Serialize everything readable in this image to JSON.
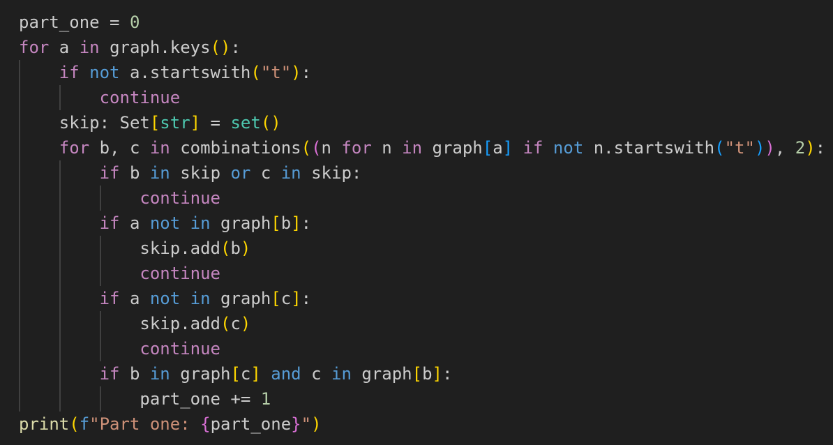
{
  "editor": {
    "language": "python",
    "theme_colors": {
      "background": "#1f1f1f",
      "default_text": "#cccccc",
      "control_keyword": "#c586c0",
      "keyword": "#569cd6",
      "function_builtin": "#dcdcaa",
      "string": "#ce9178",
      "number": "#b5cea8",
      "type": "#4ec9b0",
      "bracket_level_1": "#ffd700",
      "bracket_level_2": "#da70d6",
      "bracket_level_3": "#179fff",
      "indent_guide": "#404040"
    },
    "lines": [
      {
        "indent": 0,
        "tokens": [
          [
            "var",
            "part_one"
          ],
          [
            "var",
            " = "
          ],
          [
            "num",
            "0"
          ]
        ]
      },
      {
        "indent": 0,
        "tokens": [
          [
            "kw-ctrl",
            "for"
          ],
          [
            "var",
            " a "
          ],
          [
            "kw-ctrl",
            "in"
          ],
          [
            "var",
            " graph.keys"
          ],
          [
            "br1",
            "()"
          ],
          [
            "var",
            ":"
          ]
        ]
      },
      {
        "indent": 1,
        "tokens": [
          [
            "kw-ctrl",
            "if"
          ],
          [
            "var",
            " "
          ],
          [
            "kw",
            "not"
          ],
          [
            "var",
            " a.startswith"
          ],
          [
            "br1",
            "("
          ],
          [
            "str",
            "\"t\""
          ],
          [
            "br1",
            ")"
          ],
          [
            "var",
            ":"
          ]
        ]
      },
      {
        "indent": 2,
        "tokens": [
          [
            "kw-ctrl",
            "continue"
          ]
        ]
      },
      {
        "indent": 1,
        "tokens": [
          [
            "var",
            "skip: Set"
          ],
          [
            "br1",
            "["
          ],
          [
            "type",
            "str"
          ],
          [
            "br1",
            "]"
          ],
          [
            "var",
            " = "
          ],
          [
            "type",
            "set"
          ],
          [
            "br1",
            "()"
          ]
        ]
      },
      {
        "indent": 1,
        "tokens": [
          [
            "kw-ctrl",
            "for"
          ],
          [
            "var",
            " b, c "
          ],
          [
            "kw-ctrl",
            "in"
          ],
          [
            "var",
            " combinations"
          ],
          [
            "br1",
            "("
          ],
          [
            "br2",
            "("
          ],
          [
            "var",
            "n "
          ],
          [
            "kw-ctrl",
            "for"
          ],
          [
            "var",
            " n "
          ],
          [
            "kw-ctrl",
            "in"
          ],
          [
            "var",
            " graph"
          ],
          [
            "br3",
            "["
          ],
          [
            "var",
            "a"
          ],
          [
            "br3",
            "]"
          ],
          [
            "var",
            " "
          ],
          [
            "kw-ctrl",
            "if"
          ],
          [
            "var",
            " "
          ],
          [
            "kw",
            "not"
          ],
          [
            "var",
            " n.startswith"
          ],
          [
            "br3",
            "("
          ],
          [
            "str",
            "\"t\""
          ],
          [
            "br3",
            ")"
          ],
          [
            "br2",
            ")"
          ],
          [
            "var",
            ", "
          ],
          [
            "num",
            "2"
          ],
          [
            "br1",
            ")"
          ],
          [
            "var",
            ":"
          ]
        ]
      },
      {
        "indent": 2,
        "tokens": [
          [
            "kw-ctrl",
            "if"
          ],
          [
            "var",
            " b "
          ],
          [
            "kw",
            "in"
          ],
          [
            "var",
            " skip "
          ],
          [
            "kw",
            "or"
          ],
          [
            "var",
            " c "
          ],
          [
            "kw",
            "in"
          ],
          [
            "var",
            " skip:"
          ]
        ]
      },
      {
        "indent": 3,
        "tokens": [
          [
            "kw-ctrl",
            "continue"
          ]
        ]
      },
      {
        "indent": 2,
        "tokens": [
          [
            "kw-ctrl",
            "if"
          ],
          [
            "var",
            " a "
          ],
          [
            "kw",
            "not"
          ],
          [
            "var",
            " "
          ],
          [
            "kw",
            "in"
          ],
          [
            "var",
            " graph"
          ],
          [
            "br1",
            "["
          ],
          [
            "var",
            "b"
          ],
          [
            "br1",
            "]"
          ],
          [
            "var",
            ":"
          ]
        ]
      },
      {
        "indent": 3,
        "tokens": [
          [
            "var",
            "skip.add"
          ],
          [
            "br1",
            "("
          ],
          [
            "var",
            "b"
          ],
          [
            "br1",
            ")"
          ]
        ]
      },
      {
        "indent": 3,
        "tokens": [
          [
            "kw-ctrl",
            "continue"
          ]
        ]
      },
      {
        "indent": 2,
        "tokens": [
          [
            "kw-ctrl",
            "if"
          ],
          [
            "var",
            " a "
          ],
          [
            "kw",
            "not"
          ],
          [
            "var",
            " "
          ],
          [
            "kw",
            "in"
          ],
          [
            "var",
            " graph"
          ],
          [
            "br1",
            "["
          ],
          [
            "var",
            "c"
          ],
          [
            "br1",
            "]"
          ],
          [
            "var",
            ":"
          ]
        ]
      },
      {
        "indent": 3,
        "tokens": [
          [
            "var",
            "skip.add"
          ],
          [
            "br1",
            "("
          ],
          [
            "var",
            "c"
          ],
          [
            "br1",
            ")"
          ]
        ]
      },
      {
        "indent": 3,
        "tokens": [
          [
            "kw-ctrl",
            "continue"
          ]
        ]
      },
      {
        "indent": 2,
        "tokens": [
          [
            "kw-ctrl",
            "if"
          ],
          [
            "var",
            " b "
          ],
          [
            "kw",
            "in"
          ],
          [
            "var",
            " graph"
          ],
          [
            "br1",
            "["
          ],
          [
            "var",
            "c"
          ],
          [
            "br1",
            "]"
          ],
          [
            "var",
            " "
          ],
          [
            "kw",
            "and"
          ],
          [
            "var",
            " c "
          ],
          [
            "kw",
            "in"
          ],
          [
            "var",
            " graph"
          ],
          [
            "br1",
            "["
          ],
          [
            "var",
            "b"
          ],
          [
            "br1",
            "]"
          ],
          [
            "var",
            ":"
          ]
        ]
      },
      {
        "indent": 3,
        "tokens": [
          [
            "var",
            "part_one += "
          ],
          [
            "num",
            "1"
          ]
        ]
      },
      {
        "indent": 0,
        "tokens": [
          [
            "fn",
            "print"
          ],
          [
            "br1",
            "("
          ],
          [
            "fstr-kw",
            "f"
          ],
          [
            "str",
            "\"Part one: "
          ],
          [
            "br2",
            "{"
          ],
          [
            "var",
            "part_one"
          ],
          [
            "br2",
            "}"
          ],
          [
            "str",
            "\""
          ],
          [
            "br1",
            ")"
          ]
        ]
      }
    ]
  }
}
